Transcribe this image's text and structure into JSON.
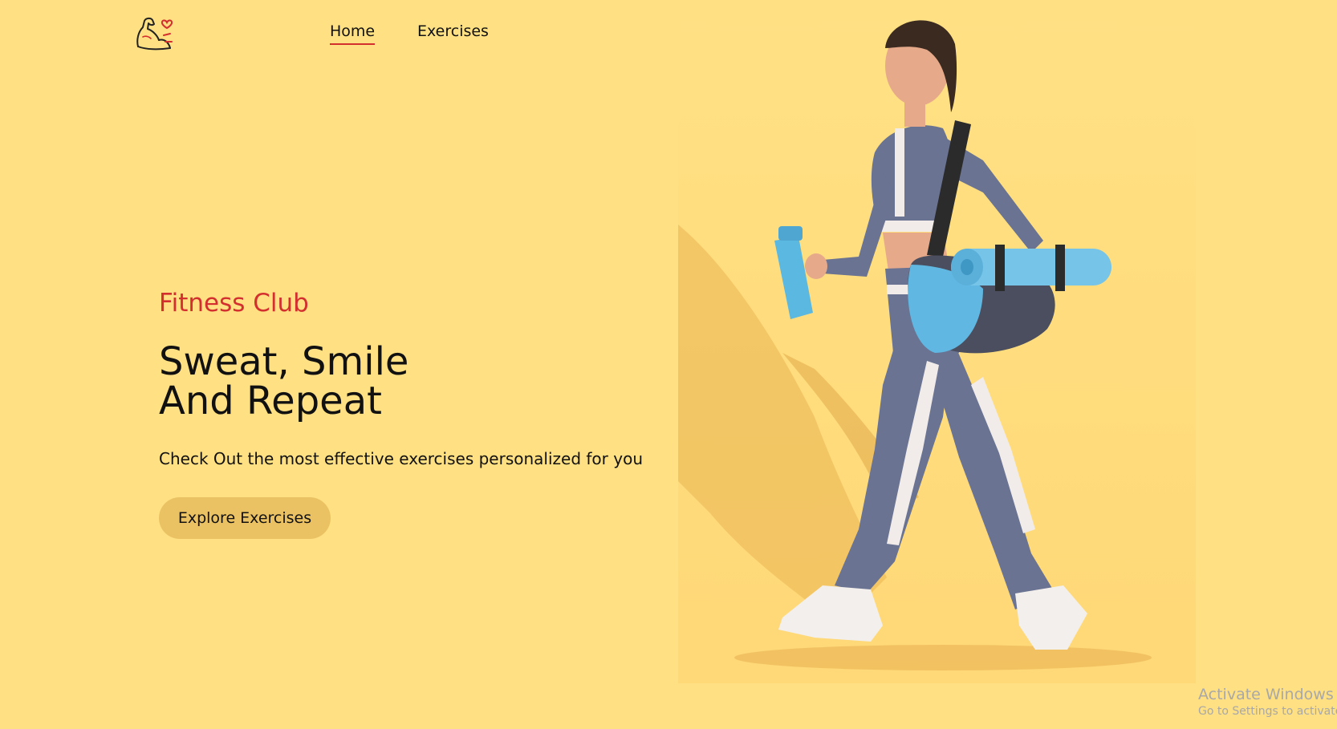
{
  "nav": {
    "logo_icon": "flexed-arm-heart-icon",
    "links": [
      {
        "label": "Home",
        "active": true
      },
      {
        "label": "Exercises",
        "active": false
      }
    ]
  },
  "hero": {
    "eyebrow": "Fitness Club",
    "title_line1": "Sweat, Smile",
    "title_line2": "And Repeat",
    "subtitle": "Check Out the most effective exercises personalized for you",
    "cta_label": "Explore Exercises",
    "image_icon": "woman-walking-with-gym-bag-image"
  },
  "watermark": {
    "title": "Activate Windows",
    "subtitle": "Go to Settings to activate"
  },
  "colors": {
    "background": "#FFE082",
    "accent": "#D32F2F",
    "button": "#EBC263",
    "text": "#111111"
  }
}
